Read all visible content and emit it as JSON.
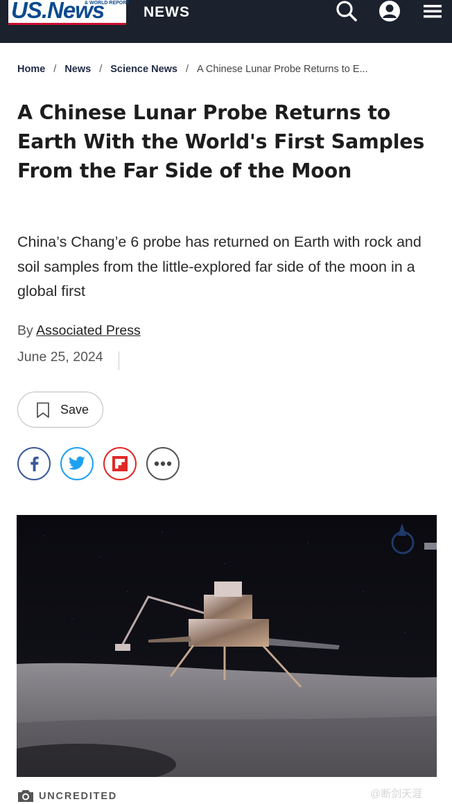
{
  "header": {
    "logo_text": "US.News",
    "logo_small": "& WORLD REPORT",
    "section": "NEWS",
    "icons": [
      "search-icon",
      "account-icon",
      "menu-icon"
    ]
  },
  "breadcrumb": {
    "home": "Home",
    "news": "News",
    "science": "Science News",
    "current": "A Chinese Lunar Probe Returns to E...",
    "separator": "/"
  },
  "article": {
    "headline": "A Chinese Lunar Probe Returns to Earth With the World's First Samples From the Far Side of the Moon",
    "dek": "China’s Chang’e 6 probe has returned on Earth with rock and soil samples from the little-explored far side of the moon in a global first",
    "by_prefix": "By",
    "author": "Associated Press",
    "date": "June 25, 2024"
  },
  "actions": {
    "save_label": "Save",
    "share_icons": [
      "facebook-icon",
      "twitter-icon",
      "flipboard-icon",
      "more-icon"
    ]
  },
  "image": {
    "credit": "UNCREDITED"
  },
  "watermark": "@断剑天涯",
  "colors": {
    "header_bg": "#1b212d",
    "logo_blue": "#0d4a8f",
    "logo_red": "#c8102e",
    "facebook": "#3b5998",
    "twitter": "#1da1f2",
    "flipboard": "#e12828",
    "more": "#444444"
  }
}
